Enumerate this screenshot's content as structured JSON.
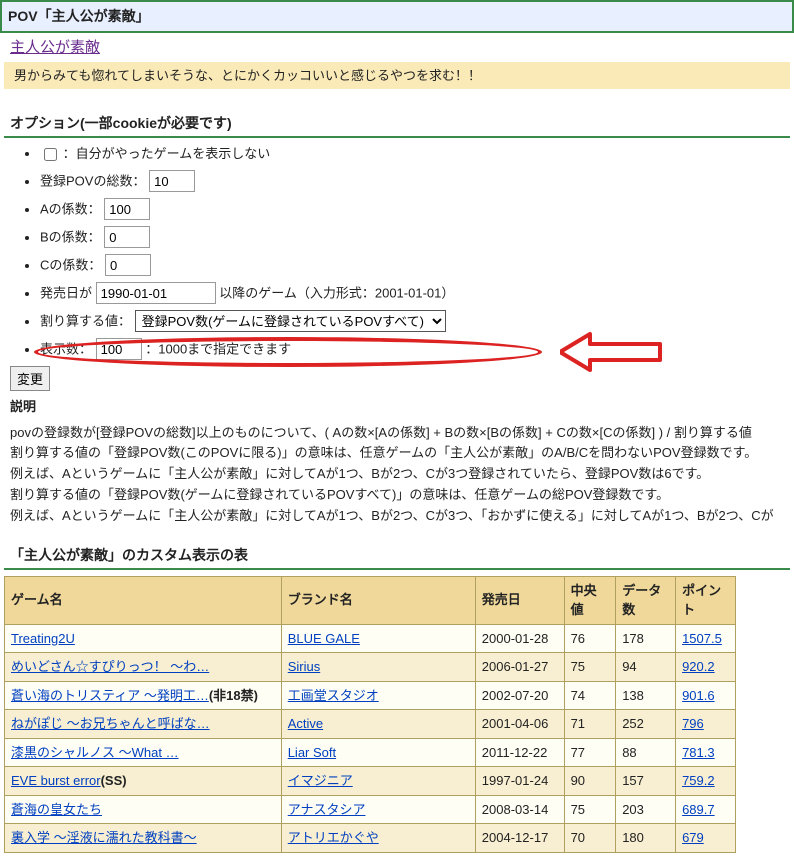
{
  "pov": {
    "header": "POV「主人公が素敵」",
    "link": "主人公が素敵",
    "description": "男からみても惚れてしまいそうな、とにかくカッコいいと感じるやつを求む！！"
  },
  "options": {
    "heading": "オプション(一部cookieが必要です)",
    "hide_played_label": "：自分がやったゲームを表示しない",
    "total_pov_label": "登録POVの総数：",
    "total_pov_value": "10",
    "coef_a_label": "Aの係数：",
    "coef_a_value": "100",
    "coef_b_label": "Bの係数：",
    "coef_b_value": "0",
    "coef_c_label": "Cの係数：",
    "coef_c_value": "0",
    "date_label": "発売日が ",
    "date_value": "1990-01-01",
    "date_after": " 以降のゲーム（入力形式：2001-01-01）",
    "divisor_label": "割り算する値：",
    "divisor_selected": "登録POV数(ゲームに登録されているPOVすべて)",
    "display_count_label": "表示数：",
    "display_count_value": "100",
    "display_count_after": "：1000まで指定できます",
    "submit_label": "変更"
  },
  "explain": {
    "heading": "説明",
    "line1": "povの登録数が[登録POVの総数]以上のものについて、( Aの数×[Aの係数] + Bの数×[Bの係数] + Cの数×[Cの係数] ) / 割り算する値",
    "line2": "割り算する値の「登録POV数(このPOVに限る)」の意味は、任意ゲームの「主人公が素敵」のA/B/Cを問わないPOV登録数です。",
    "line3": "例えば、Aというゲームに「主人公が素敵」に対してAが1つ、Bが2つ、Cが3つ登録されていたら、登録POV数は6です。",
    "line4": "割り算する値の「登録POV数(ゲームに登録されているPOVすべて)」の意味は、任意ゲームの総POV登録数です。",
    "line5": "例えば、Aというゲームに「主人公が素敵」に対してAが1つ、Bが2つ、Cが3つ、「おかずに使える」に対してAが1つ、Bが2つ、Cが"
  },
  "table": {
    "heading": "「主人公が素敵」のカスタム表示の表",
    "columns": [
      "ゲーム名",
      "ブランド名",
      "発売日",
      "中央値",
      "データ数",
      "ポイント"
    ],
    "rows": [
      {
        "game": "Treating2U",
        "game_extra": "",
        "brand": "BLUE GALE",
        "date": "2000-01-28",
        "median": "76",
        "count": "178",
        "point": "1507.5"
      },
      {
        "game": "めいどさん☆すぴりっつ！ ～わ…",
        "game_extra": "",
        "brand": "Sirius",
        "date": "2006-01-27",
        "median": "75",
        "count": "94",
        "point": "920.2"
      },
      {
        "game": "蒼い海のトリスティア ～発明工…",
        "game_extra": "(非18禁)",
        "brand": "工画堂スタジオ",
        "date": "2002-07-20",
        "median": "74",
        "count": "138",
        "point": "901.6"
      },
      {
        "game": "ねがぽじ ～お兄ちゃんと呼ばな…",
        "game_extra": "",
        "brand": "Active",
        "date": "2001-04-06",
        "median": "71",
        "count": "252",
        "point": "796"
      },
      {
        "game": "漆黒のシャルノス ～What …",
        "game_extra": "",
        "brand": "Liar Soft",
        "date": "2011-12-22",
        "median": "77",
        "count": "88",
        "point": "781.3"
      },
      {
        "game": "EVE burst error",
        "game_extra": "(SS)",
        "brand": "イマジニア",
        "date": "1997-01-24",
        "median": "90",
        "count": "157",
        "point": "759.2"
      },
      {
        "game": "蒼海の皇女たち",
        "game_extra": "",
        "brand": "アナスタシア",
        "date": "2008-03-14",
        "median": "75",
        "count": "203",
        "point": "689.7"
      },
      {
        "game": "裏入学 ～淫液に濡れた教科書～",
        "game_extra": "",
        "brand": "アトリエかぐや",
        "date": "2004-12-17",
        "median": "70",
        "count": "180",
        "point": "679"
      }
    ]
  }
}
